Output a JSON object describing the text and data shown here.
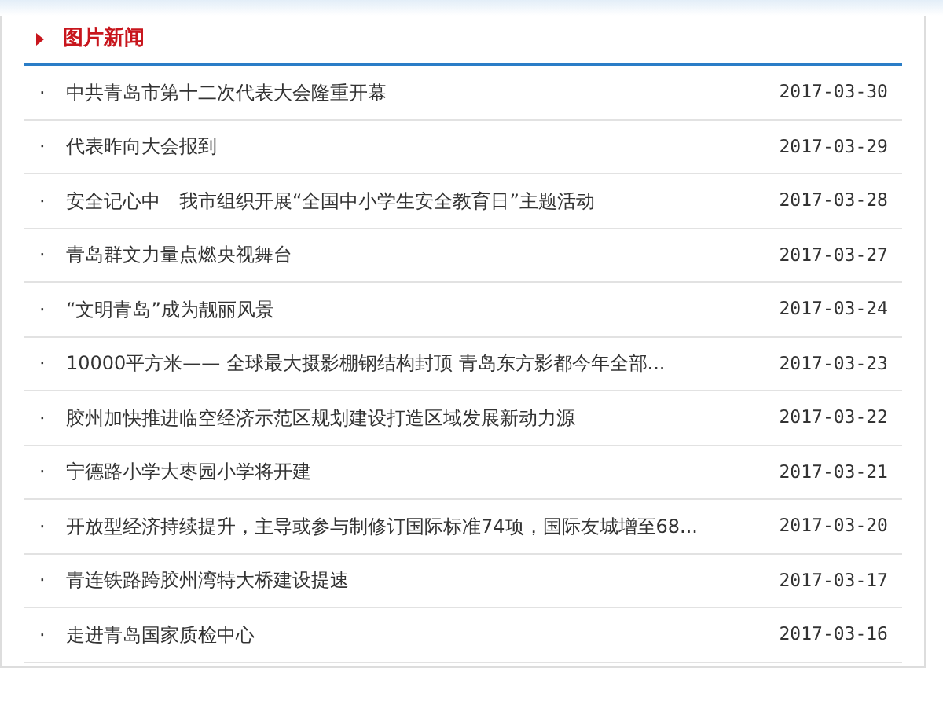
{
  "section": {
    "title": "图片新闻"
  },
  "news": [
    {
      "bullet": "·",
      "title": "中共青岛市第十二次代表大会隆重开幕",
      "date": "2017-03-30"
    },
    {
      "bullet": "·",
      "title": "代表昨向大会报到",
      "date": "2017-03-29"
    },
    {
      "bullet": "·",
      "title": "安全记心中　我市组织开展“全国中小学生安全教育日”主题活动",
      "date": "2017-03-28"
    },
    {
      "bullet": "·",
      "title": "青岛群文力量点燃央视舞台",
      "date": "2017-03-27"
    },
    {
      "bullet": "·",
      "title": "“文明青岛”成为靓丽风景",
      "date": "2017-03-24"
    },
    {
      "bullet": "·",
      "title": "10000平方米—— 全球最大摄影棚钢结构封顶 青岛东方影都今年全部...",
      "date": "2017-03-23"
    },
    {
      "bullet": "·",
      "title": "胶州加快推进临空经济示范区规划建设打造区域发展新动力源",
      "date": "2017-03-22"
    },
    {
      "bullet": "·",
      "title": "宁德路小学大枣园小学将开建",
      "date": "2017-03-21"
    },
    {
      "bullet": "·",
      "title": "开放型经济持续提升，主导或参与制修订国际标准74项，国际友城增至68...",
      "date": "2017-03-20"
    },
    {
      "bullet": "·",
      "title": "青连铁路跨胶州湾特大桥建设提速",
      "date": "2017-03-17"
    },
    {
      "bullet": "·",
      "title": "走进青岛国家质检中心",
      "date": "2017-03-16"
    }
  ]
}
